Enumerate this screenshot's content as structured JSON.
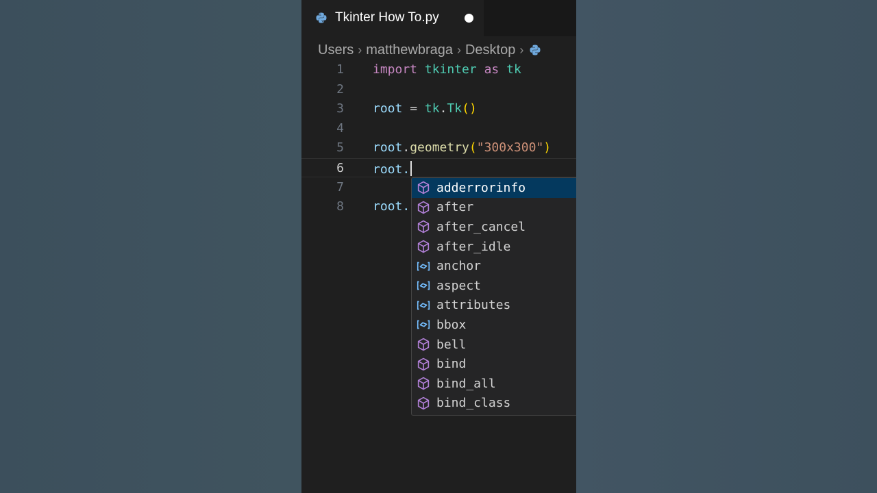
{
  "tab": {
    "title": "Tkinter How To.py",
    "icon": "python-icon",
    "dirty": true
  },
  "breadcrumb": {
    "items": [
      "Users",
      "matthewbraga",
      "Desktop"
    ],
    "trailing_icon": "python-icon"
  },
  "code": {
    "line_numbers": [
      "1",
      "2",
      "3",
      "4",
      "5",
      "6",
      "7",
      "8"
    ],
    "l1": {
      "kw": "import",
      "mod": "tkinter",
      "as": "as",
      "alias": "tk"
    },
    "l3": {
      "var": "root",
      "eq": "=",
      "obj": "tk",
      "dot": ".",
      "cls": "Tk",
      "parens": "()"
    },
    "l5": {
      "var": "root",
      "dot": ".",
      "fn": "geometry",
      "open": "(",
      "str": "\"300x300\"",
      "close": ")"
    },
    "l6": {
      "text": "root."
    },
    "l8": {
      "text": "root."
    },
    "current_line": 6
  },
  "suggestions": {
    "items": [
      {
        "label": "adderrorinfo",
        "kind": "method",
        "selected": true
      },
      {
        "label": "after",
        "kind": "method"
      },
      {
        "label": "after_cancel",
        "kind": "method"
      },
      {
        "label": "after_idle",
        "kind": "method"
      },
      {
        "label": "anchor",
        "kind": "variable"
      },
      {
        "label": "aspect",
        "kind": "variable"
      },
      {
        "label": "attributes",
        "kind": "variable"
      },
      {
        "label": "bbox",
        "kind": "variable"
      },
      {
        "label": "bell",
        "kind": "method"
      },
      {
        "label": "bind",
        "kind": "method"
      },
      {
        "label": "bind_all",
        "kind": "method"
      },
      {
        "label": "bind_class",
        "kind": "method"
      }
    ]
  },
  "colors": {
    "keyword": "#c586c0",
    "module": "#4ec9b0",
    "variable": "#9cdcfe",
    "function": "#dcdcaa",
    "string": "#ce9178",
    "selection": "#04395e",
    "method_icon": "#b180d7",
    "variable_icon": "#75beff"
  }
}
